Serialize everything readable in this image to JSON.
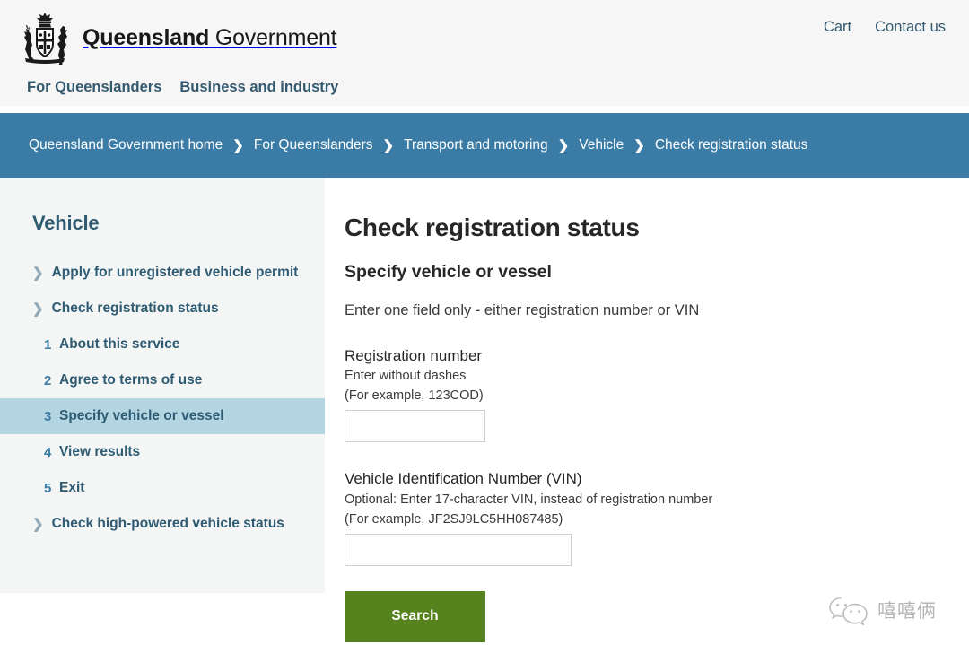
{
  "header": {
    "brand_bold": "Queensland",
    "brand_light": " Government",
    "crest_alt": "queensland-coat-of-arms",
    "links": [
      {
        "label": "Cart",
        "name": "cart-link"
      },
      {
        "label": "Contact us",
        "name": "contact-us-link"
      }
    ],
    "nav": [
      {
        "label": "For Queenslanders",
        "name": "nav-for-queenslanders"
      },
      {
        "label": "Business and industry",
        "name": "nav-business-and-industry"
      }
    ]
  },
  "breadcrumb": {
    "separator": "❯",
    "items": [
      "Queensland Government home",
      "For Queenslanders",
      "Transport and motoring",
      "Vehicle",
      "Check registration status"
    ]
  },
  "sidebar": {
    "title": "Vehicle",
    "chevron": "❯",
    "items": [
      {
        "type": "top",
        "label": "Apply for unregistered vehicle permit",
        "active": false
      },
      {
        "type": "top",
        "label": "Check registration status",
        "active": false
      },
      {
        "type": "sub",
        "num": "1",
        "label": "About this service",
        "active": false
      },
      {
        "type": "sub",
        "num": "2",
        "label": "Agree to terms of use",
        "active": false
      },
      {
        "type": "sub",
        "num": "3",
        "label": "Specify vehicle or vessel",
        "active": true
      },
      {
        "type": "sub",
        "num": "4",
        "label": "View results",
        "active": false
      },
      {
        "type": "sub",
        "num": "5",
        "label": "Exit",
        "active": false
      },
      {
        "type": "top",
        "label": "Check high-powered vehicle status",
        "active": false
      }
    ]
  },
  "main": {
    "page_title": "Check registration status",
    "section_title": "Specify vehicle or vessel",
    "intro": "Enter one field only - either registration number or VIN",
    "registration": {
      "label": "Registration number",
      "hint_line1": "Enter without dashes",
      "hint_line2": "(For example, 123COD)",
      "value": "",
      "placeholder": ""
    },
    "vin": {
      "label": "Vehicle Identification Number (VIN)",
      "hint_line1": "Optional: Enter 17-character VIN, instead of registration number",
      "hint_line2": "(For example, JF2SJ9LC5HH087485)",
      "value": "",
      "placeholder": ""
    },
    "search_button": "Search"
  },
  "watermark": {
    "icon": "wechat-icon",
    "text": "嘻嘻俩"
  },
  "colors": {
    "breadcrumb_blue": "#3b7ca6",
    "sidebar_bg": "#f4f5f5",
    "sidebar_active": "#b4d6e2",
    "heading_teal": "#2f5c73",
    "button_green": "#57831f",
    "header_bg": "#f6f6f6"
  }
}
